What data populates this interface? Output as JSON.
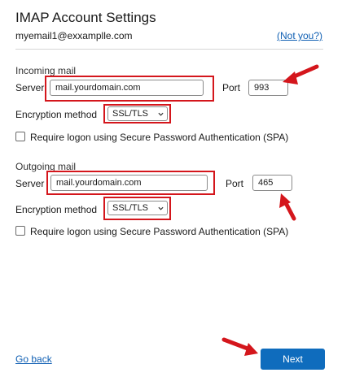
{
  "header": {
    "title": "IMAP Account Settings",
    "email": "myemail1@exxamplle.com",
    "not_you": "(Not you?)"
  },
  "incoming": {
    "section_label": "Incoming mail",
    "server_label": "Server",
    "server_value": "mail.yourdomain.com",
    "port_label": "Port",
    "port_value": "993",
    "encryption_label": "Encryption method",
    "encryption_value": "SSL/TLS",
    "spa_label": "Require logon using Secure Password Authentication (SPA)",
    "spa_checked": false
  },
  "outgoing": {
    "section_label": "Outgoing mail",
    "server_label": "Server",
    "server_value": "mail.yourdomain.com",
    "port_label": "Port",
    "port_value": "465",
    "encryption_label": "Encryption method",
    "encryption_value": "SSL/TLS",
    "spa_label": "Require logon using Secure Password Authentication (SPA)",
    "spa_checked": false
  },
  "footer": {
    "go_back": "Go back",
    "next": "Next"
  },
  "colors": {
    "accent": "#0f6cbd",
    "link": "#0f5fb3",
    "highlight": "#d4161c"
  },
  "icons": {
    "dropdown": "chevron-down-icon",
    "annotation": "red-arrow-icon"
  }
}
